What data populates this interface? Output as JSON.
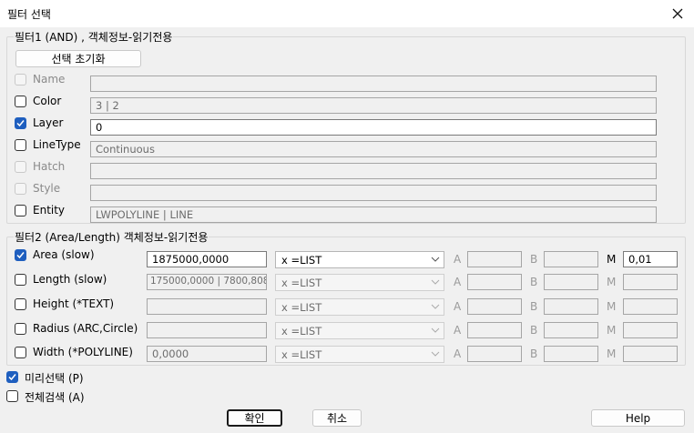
{
  "window": {
    "title": "필터 선택"
  },
  "group1": {
    "legend": "필터1 (AND) , 객체정보-읽기전용",
    "reset_button": "선택 초기화",
    "rows": [
      {
        "name": "Name",
        "value": "",
        "checked": false,
        "enabled": false
      },
      {
        "name": "Color",
        "value": "3 | 2",
        "checked": false,
        "enabled": true
      },
      {
        "name": "Layer",
        "value": "0",
        "checked": true,
        "enabled": true
      },
      {
        "name": "LineType",
        "value": "Continuous",
        "checked": false,
        "enabled": true
      },
      {
        "name": "Hatch",
        "value": "",
        "checked": false,
        "enabled": false
      },
      {
        "name": "Style",
        "value": "",
        "checked": false,
        "enabled": false
      },
      {
        "name": "Entity",
        "value": "LWPOLYLINE | LINE",
        "checked": false,
        "enabled": true
      }
    ]
  },
  "group2": {
    "legend": "필터2 (Area/Length) 객체정보-읽기전용",
    "letters": {
      "a": "A",
      "b": "B",
      "m": "M"
    },
    "rows": [
      {
        "name": "Area (slow)",
        "value": "1875000,0000",
        "combo": "x =LIST",
        "a": "",
        "b": "",
        "m": "0,01",
        "checked": true
      },
      {
        "name": "Length (slow)",
        "value": "175000,0000 | 7800,808",
        "combo": "x =LIST",
        "a": "",
        "b": "",
        "m": "",
        "checked": false
      },
      {
        "name": "Height (*TEXT)",
        "value": "",
        "combo": "x =LIST",
        "a": "",
        "b": "",
        "m": "",
        "checked": false
      },
      {
        "name": "Radius (ARC,Circle)",
        "value": "",
        "combo": "x =LIST",
        "a": "",
        "b": "",
        "m": "",
        "checked": false
      },
      {
        "name": "Width (*POLYLINE)",
        "value": "0,0000",
        "combo": "x =LIST",
        "a": "",
        "b": "",
        "m": "",
        "checked": false
      }
    ]
  },
  "options": {
    "preselect": {
      "label": "미리선택 (P)",
      "checked": true
    },
    "global_search": {
      "label": "전체검색 (A)",
      "checked": false
    }
  },
  "buttons": {
    "ok": "확인",
    "cancel": "취소",
    "help": "Help"
  }
}
